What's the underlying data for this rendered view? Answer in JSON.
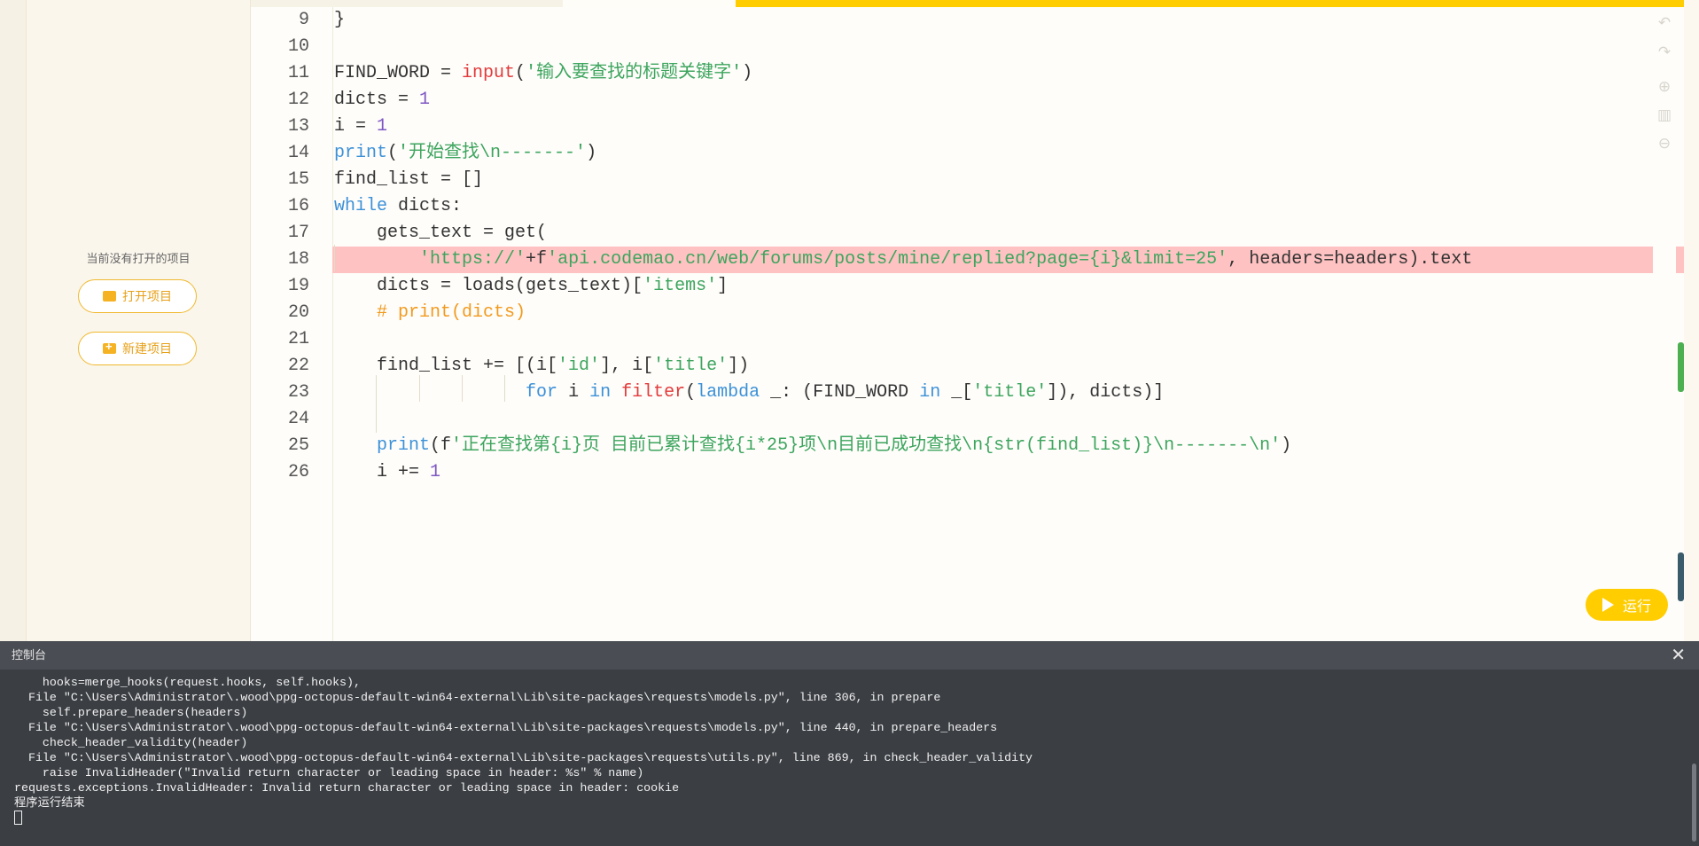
{
  "sidebar": {
    "no_project_text": "当前没有打开的项目",
    "open_button": "打开项目",
    "new_button": "新建项目"
  },
  "editor": {
    "lines": [
      {
        "num": "9",
        "tokens": [
          {
            "c": "p",
            "t": "}"
          }
        ]
      },
      {
        "num": "10",
        "tokens": []
      },
      {
        "num": "11",
        "tokens": [
          {
            "c": "p",
            "t": "FIND_WORD = "
          },
          {
            "c": "fn",
            "t": "input"
          },
          {
            "c": "p",
            "t": "("
          },
          {
            "c": "st",
            "t": "'输入要查找的标题关键字'"
          },
          {
            "c": "p",
            "t": ")"
          }
        ]
      },
      {
        "num": "12",
        "tokens": [
          {
            "c": "p",
            "t": "dicts = "
          },
          {
            "c": "nm",
            "t": "1"
          }
        ]
      },
      {
        "num": "13",
        "tokens": [
          {
            "c": "p",
            "t": "i = "
          },
          {
            "c": "nm",
            "t": "1"
          }
        ]
      },
      {
        "num": "14",
        "tokens": [
          {
            "c": "kw",
            "t": "print"
          },
          {
            "c": "p",
            "t": "("
          },
          {
            "c": "st",
            "t": "'开始查找\\n-------'"
          },
          {
            "c": "p",
            "t": ")"
          }
        ]
      },
      {
        "num": "15",
        "tokens": [
          {
            "c": "p",
            "t": "find_list = []"
          }
        ]
      },
      {
        "num": "16",
        "tokens": [
          {
            "c": "kw",
            "t": "while"
          },
          {
            "c": "p",
            "t": " dicts:"
          }
        ]
      },
      {
        "num": "17",
        "tokens": [
          {
            "c": "p",
            "t": "    gets_text = get("
          }
        ]
      },
      {
        "num": "18",
        "highlight": true,
        "tokens": [
          {
            "c": "p",
            "t": "        "
          },
          {
            "c": "st",
            "t": "'https://'"
          },
          {
            "c": "p",
            "t": "+f"
          },
          {
            "c": "st",
            "t": "'api.codemao.cn/web/forums/posts/mine/replied?page={i}&limit=25'"
          },
          {
            "c": "p",
            "t": ", headers=headers).text"
          }
        ]
      },
      {
        "num": "19",
        "tokens": [
          {
            "c": "p",
            "t": "    dicts = loads(gets_text)["
          },
          {
            "c": "st",
            "t": "'items'"
          },
          {
            "c": "p",
            "t": "]"
          }
        ]
      },
      {
        "num": "20",
        "tokens": [
          {
            "c": "p",
            "t": "    "
          },
          {
            "c": "cm",
            "t": "# print(dicts)"
          }
        ]
      },
      {
        "num": "21",
        "tokens": []
      },
      {
        "num": "22",
        "tokens": [
          {
            "c": "p",
            "t": "    find_list += [(i["
          },
          {
            "c": "st",
            "t": "'id'"
          },
          {
            "c": "p",
            "t": "], i["
          },
          {
            "c": "st",
            "t": "'title'"
          },
          {
            "c": "p",
            "t": "])"
          }
        ]
      },
      {
        "num": "23",
        "tokens": [
          {
            "c": "p",
            "t": "                  "
          },
          {
            "c": "kw",
            "t": "for"
          },
          {
            "c": "p",
            "t": " i "
          },
          {
            "c": "kw",
            "t": "in"
          },
          {
            "c": "p",
            "t": " "
          },
          {
            "c": "fn",
            "t": "filter"
          },
          {
            "c": "p",
            "t": "("
          },
          {
            "c": "kw",
            "t": "lambda"
          },
          {
            "c": "p",
            "t": " _: (FIND_WORD "
          },
          {
            "c": "kw",
            "t": "in"
          },
          {
            "c": "p",
            "t": " _["
          },
          {
            "c": "st",
            "t": "'title'"
          },
          {
            "c": "p",
            "t": "]), dicts)]"
          }
        ]
      },
      {
        "num": "24",
        "tokens": []
      },
      {
        "num": "25",
        "tokens": [
          {
            "c": "p",
            "t": "    "
          },
          {
            "c": "kw",
            "t": "print"
          },
          {
            "c": "p",
            "t": "(f"
          },
          {
            "c": "st",
            "t": "'正在查找第{i}页 目前已累计查找{i*25}项\\n目前已成功查找\\n{str(find_list)}\\n-------\\n'"
          },
          {
            "c": "p",
            "t": ")"
          }
        ]
      },
      {
        "num": "26",
        "tokens": [
          {
            "c": "p",
            "t": "    i += "
          },
          {
            "c": "nm",
            "t": "1"
          }
        ]
      }
    ]
  },
  "run_button": "运行",
  "console": {
    "title": "控制台",
    "close_glyph": "✕",
    "lines": [
      "    hooks=merge_hooks(request.hooks, self.hooks),",
      "  File \"C:\\Users\\Administrator\\.wood\\ppg-octopus-default-win64-external\\Lib\\site-packages\\requests\\models.py\", line 306, in prepare",
      "    self.prepare_headers(headers)",
      "  File \"C:\\Users\\Administrator\\.wood\\ppg-octopus-default-win64-external\\Lib\\site-packages\\requests\\models.py\", line 440, in prepare_headers",
      "    check_header_validity(header)",
      "  File \"C:\\Users\\Administrator\\.wood\\ppg-octopus-default-win64-external\\Lib\\site-packages\\requests\\utils.py\", line 869, in check_header_validity",
      "    raise InvalidHeader(\"Invalid return character or leading space in header: %s\" % name)",
      "requests.exceptions.InvalidHeader: Invalid return character or leading space in header: cookie",
      "程序运行结束"
    ]
  },
  "colors": {
    "accent": "#ffcd00",
    "keyword": "#3d91d8",
    "string": "#3da55e",
    "number": "#7e57c2",
    "comment": "#f29a1e",
    "builtin": "#e23b3b",
    "highlight": "#ffc2c2",
    "console_bg": "#3b3e43"
  },
  "icons": [
    "folder-open-icon",
    "folder-plus-icon",
    "undo-icon",
    "redo-icon",
    "zoom-in-icon",
    "book-icon",
    "zoom-out-icon",
    "play-icon",
    "close-icon"
  ]
}
